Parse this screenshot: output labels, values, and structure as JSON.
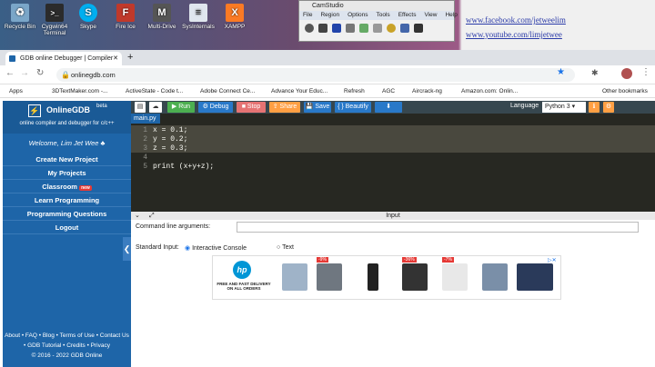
{
  "desktop": {
    "icons": [
      {
        "label": "Recycle Bin",
        "color": "#7aa6c8",
        "glyph": "♻"
      },
      {
        "label": "Cygwin64 Terminal",
        "color": "#2b2b2b",
        "glyph": ">_"
      },
      {
        "label": "Skype",
        "color": "#00aff0",
        "glyph": "S"
      },
      {
        "label": "Fire Ice",
        "color": "#c0392b",
        "glyph": "F"
      },
      {
        "label": "Multi-Drive",
        "color": "#555",
        "glyph": "M"
      },
      {
        "label": "SysInternals",
        "color": "#dfe6ee",
        "glyph": "≡"
      },
      {
        "label": "XAMPP",
        "color": "#fb7a24",
        "glyph": "X"
      }
    ]
  },
  "camstudio": {
    "title": "CamStudio",
    "menu": [
      "File",
      "Region",
      "Options",
      "Tools",
      "Effects",
      "View",
      "Help"
    ]
  },
  "overlay_links": [
    "www.facebook.com/jetweelim",
    "www.youtube.com/limjetwee"
  ],
  "browser": {
    "tab_title": "GDB online Debugger | Compiler",
    "url": "onlinegdb.com",
    "bookmarks": [
      "Apps",
      "3DTextMaker.com -...",
      "ActiveState - Code t...",
      "Adobe Connect Ce...",
      "Advance Your Educ...",
      "Refresh",
      "AGC",
      "Aircrack-ng",
      "Amazon.com: Onlin...",
      "Other bookmarks"
    ]
  },
  "sidebar": {
    "logo": "OnlineGDB",
    "beta": "beta",
    "tagline": "online compiler and debugger for c/c++",
    "welcome": "Welcome, Lim Jet Wee ♣",
    "menu": [
      "Create New Project",
      "My Projects",
      "Classroom",
      "Learn Programming",
      "Programming Questions",
      "Logout"
    ],
    "new_badge": "new",
    "footer": [
      "About • FAQ • Blog • Terms of Use • Contact Us",
      "• GDB Tutorial • Credits • Privacy",
      "© 2016 - 2022 GDB Online"
    ]
  },
  "toolbar": {
    "run": "▶ Run",
    "debug": "⚙ Debug",
    "stop": "■ Stop",
    "share": "⇪ Share",
    "save": "💾 Save",
    "beautify": "{ } Beautify",
    "language_label": "Language",
    "language": "Python 3"
  },
  "editor": {
    "file_tab": "main.py",
    "lines": [
      {
        "n": "1",
        "code": "x = 0.1;"
      },
      {
        "n": "2",
        "code": "y = 0.2;"
      },
      {
        "n": "3",
        "code": "z = 0.3;"
      },
      {
        "n": "4",
        "code": ""
      },
      {
        "n": "5",
        "code": "print (x+y+z);"
      }
    ]
  },
  "input": {
    "header": "Input",
    "cmd_label": "Command line arguments:",
    "stdin_label": "Standard Input:",
    "opt1": "Interactive Console",
    "opt2": "Text"
  },
  "ad": {
    "brand": "hp",
    "tagline": "FREE AND FAST DELIVERY ON ALL ORDERS",
    "discounts": [
      "-9%",
      "-36%",
      "-7%"
    ]
  }
}
